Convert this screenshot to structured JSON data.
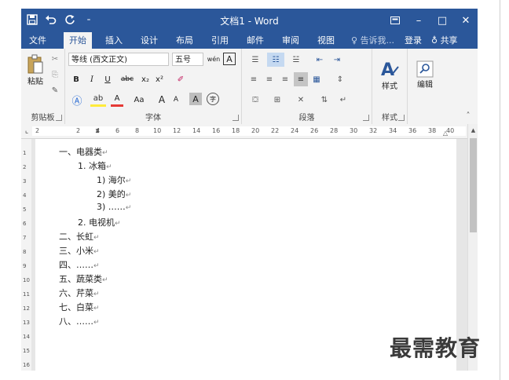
{
  "window": {
    "title": "文档1 - Word"
  },
  "qat": {
    "save_icon": "save-icon",
    "undo_icon": "undo-icon",
    "redo_icon": "redo-icon",
    "customize_icon": "customize-icon"
  },
  "window_controls": {
    "restore_ribbon": "ribbon-display-icon",
    "minimize": "–",
    "maximize": "□",
    "close": "✕"
  },
  "tabs": [
    {
      "label": "文件"
    },
    {
      "label": "开始"
    },
    {
      "label": "插入"
    },
    {
      "label": "设计"
    },
    {
      "label": "布局"
    },
    {
      "label": "引用"
    },
    {
      "label": "邮件"
    },
    {
      "label": "审阅"
    },
    {
      "label": "视图"
    }
  ],
  "active_tab": "开始",
  "tell_me": "告诉我...",
  "sign_in": "登录",
  "share": "共享",
  "ribbon": {
    "clipboard": {
      "label": "剪贴板",
      "paste": "粘贴"
    },
    "font": {
      "label": "字体",
      "font_name": "等线 (西文正文)",
      "font_size": "五号",
      "bold": "B",
      "italic": "I",
      "underline": "U",
      "strike": "abc",
      "subscript": "x₂",
      "superscript": "x²",
      "change_case": "Aa",
      "grow": "A",
      "shrink": "A",
      "wen": "wén",
      "char_border": "A",
      "char_shading": "A",
      "enclose": "字"
    },
    "paragraph": {
      "label": "段落"
    },
    "styles": {
      "label": "样式",
      "button": "样式"
    },
    "editing": {
      "button": "编辑"
    }
  },
  "ruler": {
    "numbers": [
      "2",
      "2",
      "4",
      "6",
      "8",
      "10",
      "12",
      "14",
      "16",
      "18",
      "20",
      "22",
      "24",
      "26",
      "28",
      "30",
      "32",
      "34",
      "36",
      "38",
      "40"
    ]
  },
  "vruler": {
    "numbers": [
      "1",
      "2",
      "3",
      "4",
      "5",
      "6",
      "7",
      "8",
      "9",
      "10",
      "11",
      "12",
      "13",
      "14",
      "15",
      "16"
    ]
  },
  "document": {
    "lines": [
      {
        "text": "一、电器类",
        "mark": "↵"
      },
      {
        "text": "1.   冰箱",
        "mark": "↵"
      },
      {
        "text": "1)   海尔",
        "mark": "↵"
      },
      {
        "text": "2)   美的",
        "mark": "↵"
      },
      {
        "text": "3)   ……",
        "mark": "↵"
      },
      {
        "text": "2.   电视机",
        "mark": "↵"
      },
      {
        "text": "二、长虹",
        "mark": "↵"
      },
      {
        "text": "三、小米",
        "mark": "↵"
      },
      {
        "text": "四、……",
        "mark": "↵"
      },
      {
        "text": "五、蔬菜类",
        "mark": "↵"
      },
      {
        "text": "六、芹菜",
        "mark": "↵"
      },
      {
        "text": "七、白菜",
        "mark": "↵"
      },
      {
        "text": "八、……",
        "mark": "↵"
      }
    ]
  },
  "watermark": "最需教育"
}
